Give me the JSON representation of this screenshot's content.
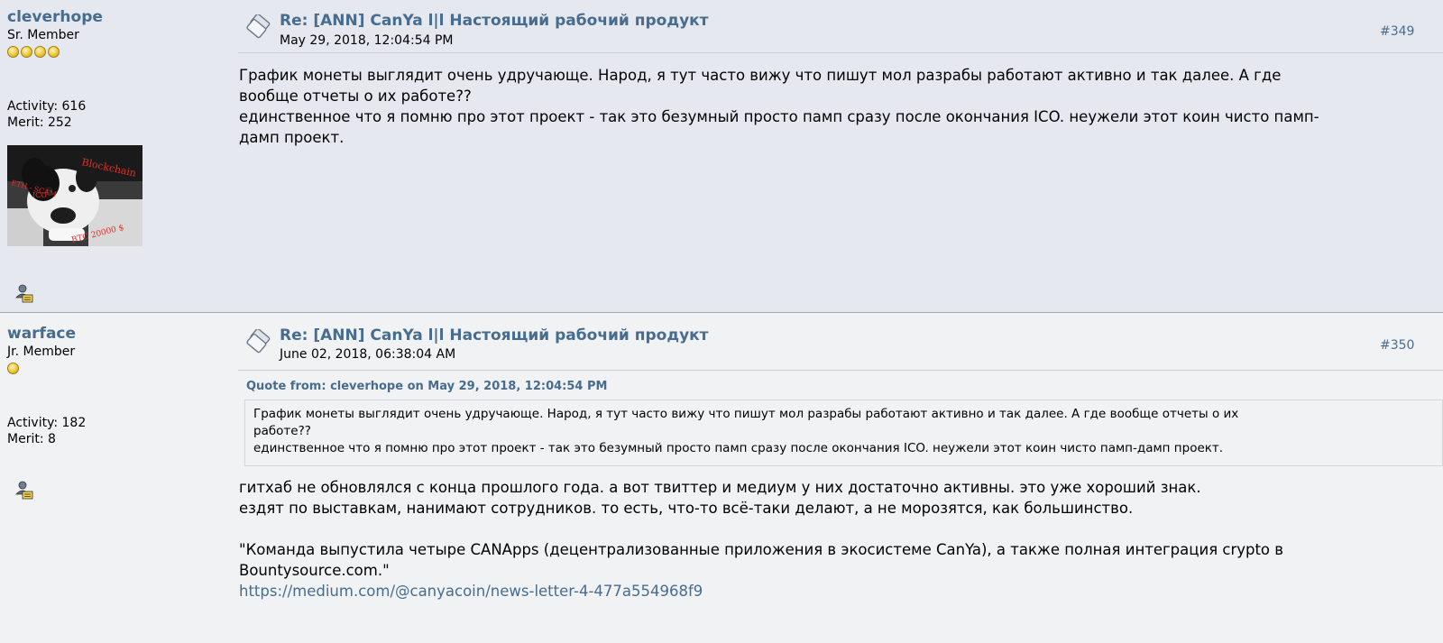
{
  "posts": [
    {
      "author": {
        "name": "cleverhope",
        "rank": "Sr. Member",
        "stars": 4,
        "activity": "Activity: 616",
        "merit": "Merit: 252"
      },
      "avatar_text": {
        "line1": "Blockchain",
        "line2": "ETH - SCAM",
        "line3": "ICO",
        "line4": "BTC 20000 $"
      },
      "subject": "Re: [ANN] CanYa l|l Настоящий рабочий продукт",
      "date": "May 29, 2018, 12:04:54 PM",
      "number": "#349",
      "body": [
        "График монеты выглядит очень удручающе. Народ, я тут часто вижу что пишут мол разрабы работают активно и так далее. А где",
        "вообще отчеты о их работе??",
        "единственное что я помню про этот проект - так это безумный просто памп сразу после окончания ICO. неужели этот коин чисто памп-",
        "дамп проект."
      ]
    },
    {
      "author": {
        "name": "warface",
        "rank": "Jr. Member",
        "stars": 1,
        "activity": "Activity: 182",
        "merit": "Merit: 8"
      },
      "subject": "Re: [ANN] CanYa l|l Настоящий рабочий продукт",
      "date": "June 02, 2018, 06:38:04 AM",
      "number": "#350",
      "quote": {
        "header": "Quote from: cleverhope on May 29, 2018, 12:04:54 PM",
        "lines": [
          "График монеты выглядит очень удручающе. Народ, я тут часто вижу что пишут мол разрабы работают активно и так далее. А где вообще отчеты о их",
          "работе??",
          "единственное что я помню про этот проект - так это безумный просто памп сразу после окончания ICO. неужели этот коин чисто памп-дамп проект."
        ]
      },
      "body": [
        "гитхаб не обновлялся с конца прошлого года. а вот твиттер и медиум у них достаточно активны. это уже хороший знак.",
        "ездят по выставкам, нанимают сотрудников. то есть, что-то всё-таки делают, а не морозятся, как большинство.",
        "",
        "\"Команда выпустила четыре CANApps (децентрализованные приложения в экосистеме CanYa), а также полная интеграция crypto в",
        "Bountysource.com.\""
      ],
      "link": "https://medium.com/@canyacoin/news-letter-4-477a554968f9"
    }
  ],
  "colors": {
    "link": "#476c8e",
    "post_bg_1": "#e5e8ef",
    "post_bg_2": "#f1f2f4"
  },
  "icons": {
    "subject": "post-subject-icon",
    "profile": "profile-icon",
    "rank": "star-icon"
  }
}
